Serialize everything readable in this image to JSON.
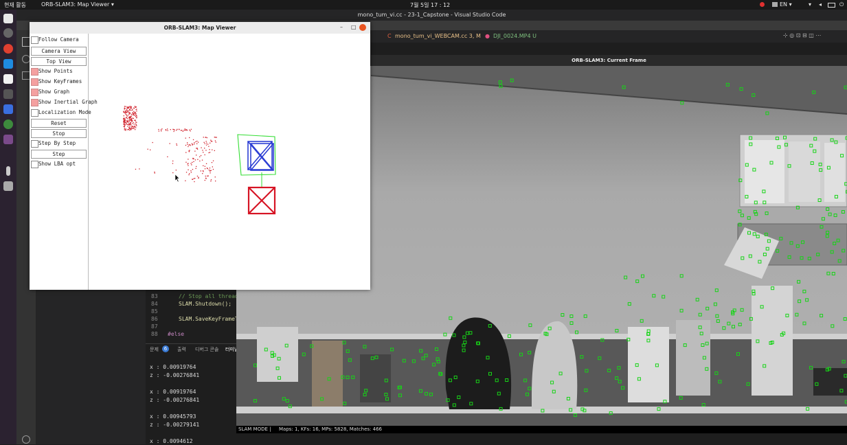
{
  "topbar": {
    "activities": "현재 활동",
    "app_menu": "ORB-SLAM3: Map Viewer ▾",
    "clock": "7월 5일 17 : 12",
    "lang": "EN ▾"
  },
  "vscode": {
    "window_title": "mono_tum_vi.cc - 23-1_Capstone - Visual Studio Code",
    "tabs": [
      "mono_tum_vi_WEBCAM.cc 3, M",
      "DJI_0024.MP4 U"
    ],
    "tab_marks": [
      "C",
      "●"
    ],
    "editor": {
      "line_numbers": [
        "83",
        "84",
        "85",
        "86",
        "87",
        "88"
      ],
      "lines": [
        "// Stop all threads",
        "SLAM.Shutdown();",
        "",
        "SLAM.SaveKeyFrameTra",
        "",
        "#else"
      ]
    },
    "panel": {
      "tabs": [
        "문제",
        "출력",
        "디버그 콘솔",
        "터미널"
      ],
      "problem_count": "6",
      "terminal_lines": [
        "x : 0.00919764",
        "z : -0.00276841",
        "",
        "x : 0.00919764",
        "z : -0.00276841",
        "",
        "x : 0.00945793",
        "z : -0.00279141",
        "",
        "x : 0.0094612"
      ]
    }
  },
  "map_viewer": {
    "title": "ORB-SLAM3: Map Viewer",
    "window_controls": [
      "–",
      "□"
    ],
    "controls": [
      {
        "type": "checkbox",
        "label": "Follow Camera",
        "checked": false
      },
      {
        "type": "button",
        "label": "Camera View"
      },
      {
        "type": "button",
        "label": "Top View"
      },
      {
        "type": "checkbox",
        "label": "Show Points",
        "checked": true
      },
      {
        "type": "checkbox",
        "label": "Show KeyFrames",
        "checked": true
      },
      {
        "type": "checkbox",
        "label": "Show Graph",
        "checked": true
      },
      {
        "type": "checkbox",
        "label": "Show Inertial Graph",
        "checked": true
      },
      {
        "type": "checkbox",
        "label": "Localization Mode",
        "checked": false
      },
      {
        "type": "button",
        "label": "Reset"
      },
      {
        "type": "button",
        "label": "Stop"
      },
      {
        "type": "checkbox",
        "label": "Step By Step",
        "checked": false
      },
      {
        "type": "button",
        "label": "Step"
      },
      {
        "type": "checkbox",
        "label": "Show LBA opt",
        "checked": false
      }
    ],
    "colors": {
      "points": "#d0202a",
      "keyframe": "#2d3fd4",
      "current": "#d61424",
      "graph": "#33dd33"
    }
  },
  "current_frame": {
    "title": "ORB-SLAM3: Current Frame",
    "status": {
      "mode": "SLAM MODE |",
      "stats": "Maps: 1, KFs: 16, MPs: 5828, Matches: 466"
    },
    "feature_color": "#17d417"
  }
}
